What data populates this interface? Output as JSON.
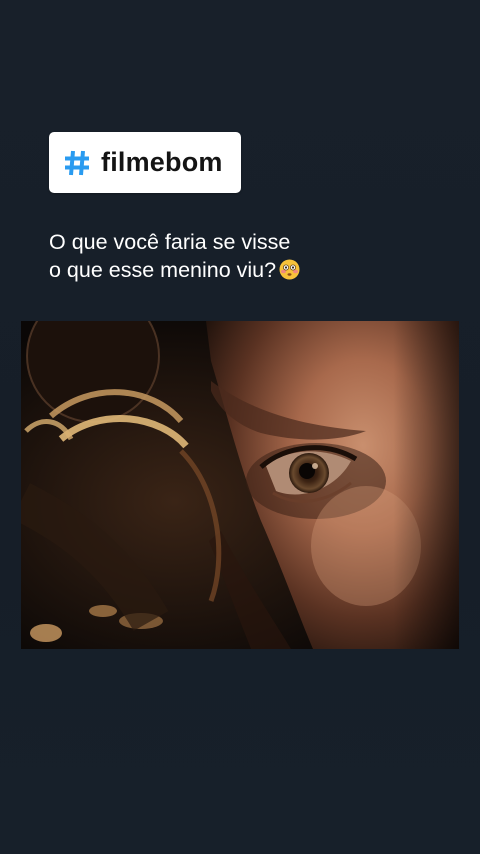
{
  "story": {
    "hashtag": {
      "icon": "hashtag-icon",
      "accent_color": "#2a9bf0",
      "text": "filmebom"
    },
    "caption": {
      "line1": "O que você faria se visse",
      "line2": "o que esse menino viu?",
      "emoji": "flushed-face-emoji"
    },
    "media": {
      "type": "video-still",
      "subject": "close-up of a boy's eye looking through a lens"
    }
  }
}
